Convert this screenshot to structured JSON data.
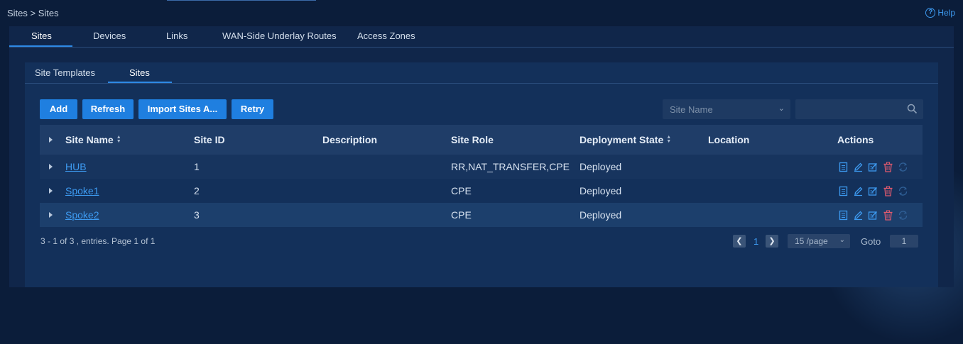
{
  "breadcrumb": "Sites > Sites",
  "help_label": "Help",
  "main_tabs": [
    {
      "label": "Sites"
    },
    {
      "label": "Devices"
    },
    {
      "label": "Links"
    },
    {
      "label": "WAN-Side Underlay Routes"
    },
    {
      "label": "Access Zones"
    }
  ],
  "sub_tabs": [
    {
      "label": "Site Templates"
    },
    {
      "label": "Sites"
    }
  ],
  "toolbar": {
    "add": "Add",
    "refresh": "Refresh",
    "import": "Import Sites A...",
    "retry": "Retry"
  },
  "filter": {
    "select_placeholder": "Site Name",
    "search_value": ""
  },
  "table": {
    "headers": [
      "Site Name",
      "Site ID",
      "Description",
      "Site Role",
      "Deployment State",
      "Location",
      "Actions"
    ],
    "rows": [
      {
        "name": "HUB",
        "id": "1",
        "description": "",
        "role": "RR,NAT_TRANSFER,CPE",
        "state": "Deployed",
        "location": ""
      },
      {
        "name": "Spoke1",
        "id": "2",
        "description": "",
        "role": "CPE",
        "state": "Deployed",
        "location": ""
      },
      {
        "name": "Spoke2",
        "id": "3",
        "description": "",
        "role": "CPE",
        "state": "Deployed",
        "location": ""
      }
    ]
  },
  "pagination": {
    "summary": "3 - 1 of 3 , entries. Page 1 of 1",
    "current_page": "1",
    "per_page": "15 /page",
    "goto_label": "Goto",
    "goto_value": "1"
  },
  "icons": {
    "detail": "document-icon",
    "edit": "pencil-icon",
    "edit_config": "edit-box-icon",
    "delete": "trash-icon",
    "sync": "refresh-icon"
  },
  "colors": {
    "accent": "#1f7fe0",
    "link": "#3d9af0",
    "delete": "#e05a6e"
  }
}
